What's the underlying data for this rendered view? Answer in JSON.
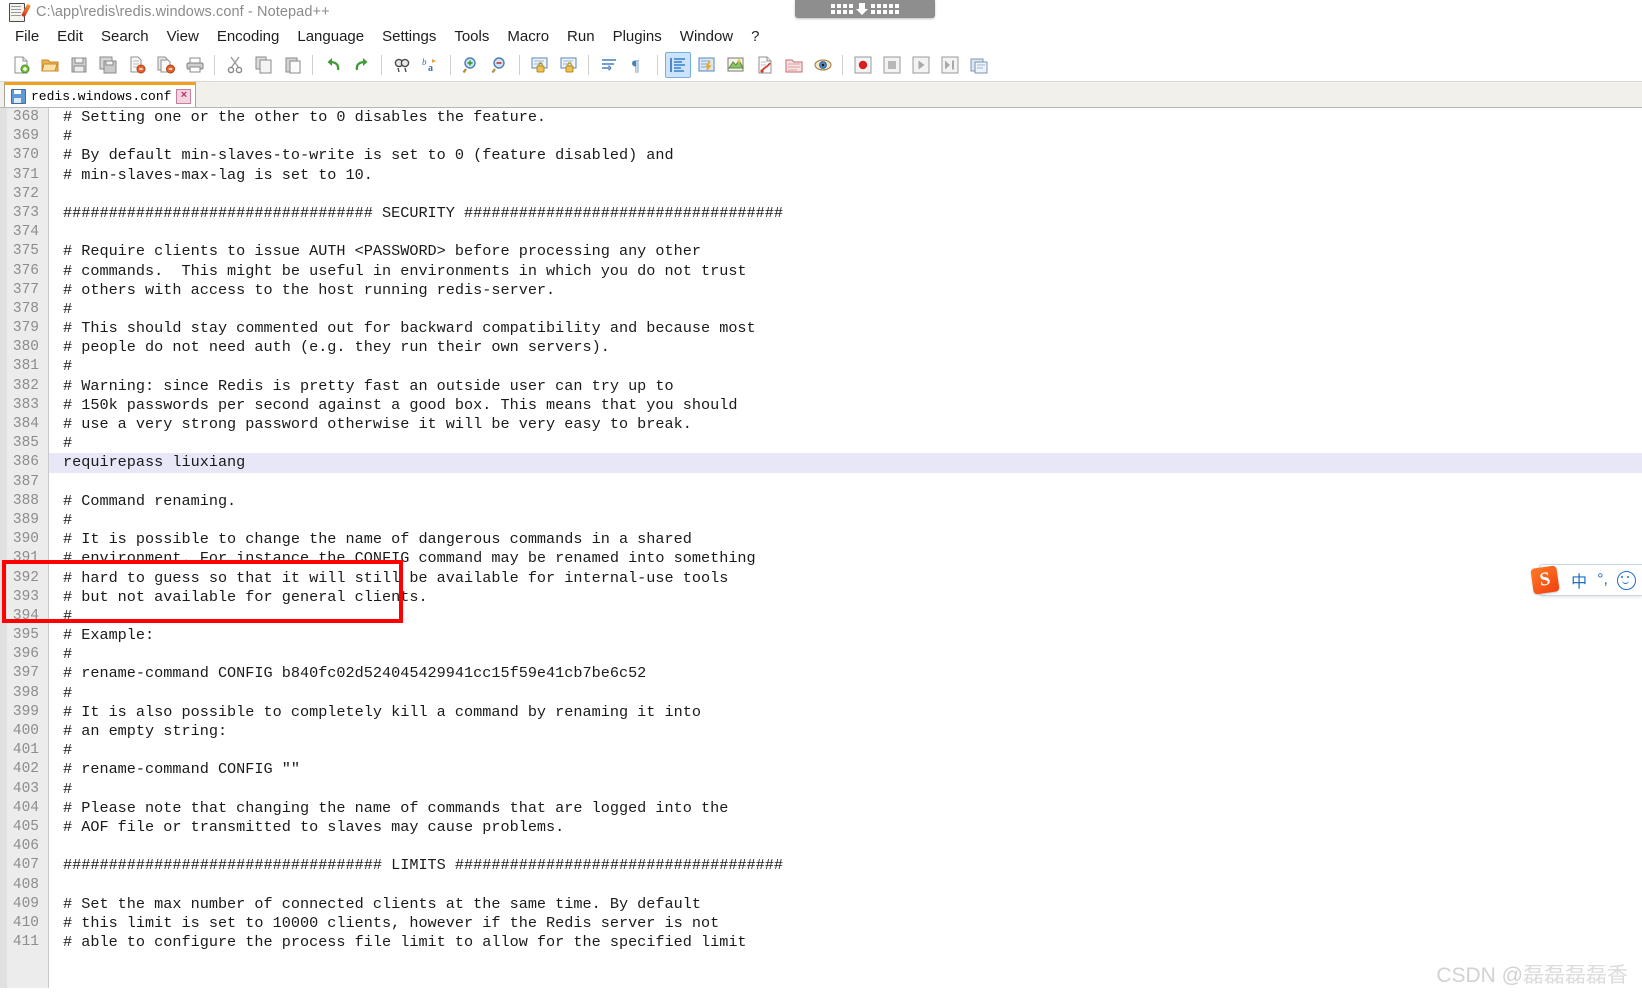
{
  "window": {
    "title": "C:\\app\\redis\\redis.windows.conf - Notepad++",
    "app_icon": "notepad-plus-plus-icon"
  },
  "capture_widget": {
    "arrow_icon": "download-arrow-icon",
    "grid_icon": "dot-grid-icon"
  },
  "menu": {
    "items": [
      {
        "label": "File"
      },
      {
        "label": "Edit"
      },
      {
        "label": "Search"
      },
      {
        "label": "View"
      },
      {
        "label": "Encoding"
      },
      {
        "label": "Language"
      },
      {
        "label": "Settings"
      },
      {
        "label": "Tools"
      },
      {
        "label": "Macro"
      },
      {
        "label": "Run"
      },
      {
        "label": "Plugins"
      },
      {
        "label": "Window"
      },
      {
        "label": "?"
      }
    ]
  },
  "toolbar": {
    "groups": [
      [
        "new-file-icon",
        "open-file-icon",
        "save-icon",
        "save-all-icon",
        "close-file-icon",
        "close-all-files-icon",
        "print-icon"
      ],
      [
        "cut-icon",
        "copy-icon",
        "paste-icon"
      ],
      [
        "undo-icon",
        "redo-icon"
      ],
      [
        "find-icon",
        "replace-icon"
      ],
      [
        "zoom-in-icon",
        "zoom-out-icon"
      ],
      [
        "sync-vertical-scroll-icon",
        "sync-horizontal-scroll-icon"
      ],
      [
        "word-wrap-icon",
        "show-all-characters-icon"
      ],
      [
        "indent-guide-icon",
        "user-defined-dialog-icon",
        "document-map-icon",
        "function-list-icon",
        "folder-as-workspace-icon",
        "monitoring-icon"
      ],
      [
        "macro-record-icon",
        "macro-stop-icon",
        "macro-play-icon",
        "macro-run-multiple-icon",
        "macro-save-icon"
      ]
    ],
    "active_icon": "indent-guide-icon"
  },
  "tabs": [
    {
      "label": "redis.windows.conf",
      "modified_icon": "saved-disk-icon",
      "close_label": "×",
      "active": true
    }
  ],
  "editor": {
    "first_line_number": 368,
    "current_line_number": 386,
    "lines": [
      {
        "n": 368,
        "text": "# Setting one or the other to 0 disables the feature."
      },
      {
        "n": 369,
        "text": "#"
      },
      {
        "n": 370,
        "text": "# By default min-slaves-to-write is set to 0 (feature disabled) and"
      },
      {
        "n": 371,
        "text": "# min-slaves-max-lag is set to 10."
      },
      {
        "n": 372,
        "text": ""
      },
      {
        "n": 373,
        "text": "################################## SECURITY ###################################"
      },
      {
        "n": 374,
        "text": ""
      },
      {
        "n": 375,
        "text": "# Require clients to issue AUTH <PASSWORD> before processing any other"
      },
      {
        "n": 376,
        "text": "# commands.  This might be useful in environments in which you do not trust"
      },
      {
        "n": 377,
        "text": "# others with access to the host running redis-server."
      },
      {
        "n": 378,
        "text": "#"
      },
      {
        "n": 379,
        "text": "# This should stay commented out for backward compatibility and because most"
      },
      {
        "n": 380,
        "text": "# people do not need auth (e.g. they run their own servers)."
      },
      {
        "n": 381,
        "text": "#"
      },
      {
        "n": 382,
        "text": "# Warning: since Redis is pretty fast an outside user can try up to"
      },
      {
        "n": 383,
        "text": "# 150k passwords per second against a good box. This means that you should"
      },
      {
        "n": 384,
        "text": "# use a very strong password otherwise it will be very easy to break."
      },
      {
        "n": 385,
        "text": "#"
      },
      {
        "n": 386,
        "text": "requirepass liuxiang"
      },
      {
        "n": 387,
        "text": ""
      },
      {
        "n": 388,
        "text": "# Command renaming."
      },
      {
        "n": 389,
        "text": "#"
      },
      {
        "n": 390,
        "text": "# It is possible to change the name of dangerous commands in a shared"
      },
      {
        "n": 391,
        "text": "# environment. For instance the CONFIG command may be renamed into something"
      },
      {
        "n": 392,
        "text": "# hard to guess so that it will still be available for internal-use tools"
      },
      {
        "n": 393,
        "text": "# but not available for general clients."
      },
      {
        "n": 394,
        "text": "#"
      },
      {
        "n": 395,
        "text": "# Example:"
      },
      {
        "n": 396,
        "text": "#"
      },
      {
        "n": 397,
        "text": "# rename-command CONFIG b840fc02d524045429941cc15f59e41cb7be6c52"
      },
      {
        "n": 398,
        "text": "#"
      },
      {
        "n": 399,
        "text": "# It is also possible to completely kill a command by renaming it into"
      },
      {
        "n": 400,
        "text": "# an empty string:"
      },
      {
        "n": 401,
        "text": "#"
      },
      {
        "n": 402,
        "text": "# rename-command CONFIG \"\""
      },
      {
        "n": 403,
        "text": "#"
      },
      {
        "n": 404,
        "text": "# Please note that changing the name of commands that are logged into the"
      },
      {
        "n": 405,
        "text": "# AOF file or transmitted to slaves may cause problems."
      },
      {
        "n": 406,
        "text": ""
      },
      {
        "n": 407,
        "text": "################################### LIMITS ####################################"
      },
      {
        "n": 408,
        "text": ""
      },
      {
        "n": 409,
        "text": "# Set the max number of connected clients at the same time. By default"
      },
      {
        "n": 410,
        "text": "# this limit is set to 10000 clients, however if the Redis server is not"
      },
      {
        "n": 411,
        "text": "# able to configure the process file limit to allow for the specified limit"
      }
    ]
  },
  "annotation": {
    "shape": "red-rectangle",
    "color": "#ff0000",
    "covers_lines": "384-387"
  },
  "ime_bar": {
    "logo_label": "S",
    "logo_name": "sogou-ime-logo",
    "mode_label": "中",
    "punctuation_label": "°,",
    "smiley_name": "emoji-icon"
  },
  "watermark": {
    "prefix": "CSDN @",
    "author": "磊磊磊磊香"
  },
  "colors": {
    "current_line_highlight": "#e7e7f7",
    "gutter_bg": "#ececec",
    "tab_active_top": "#f0a01e",
    "annotation": "#ff0000",
    "ime_accent": "#1f6fc4"
  }
}
